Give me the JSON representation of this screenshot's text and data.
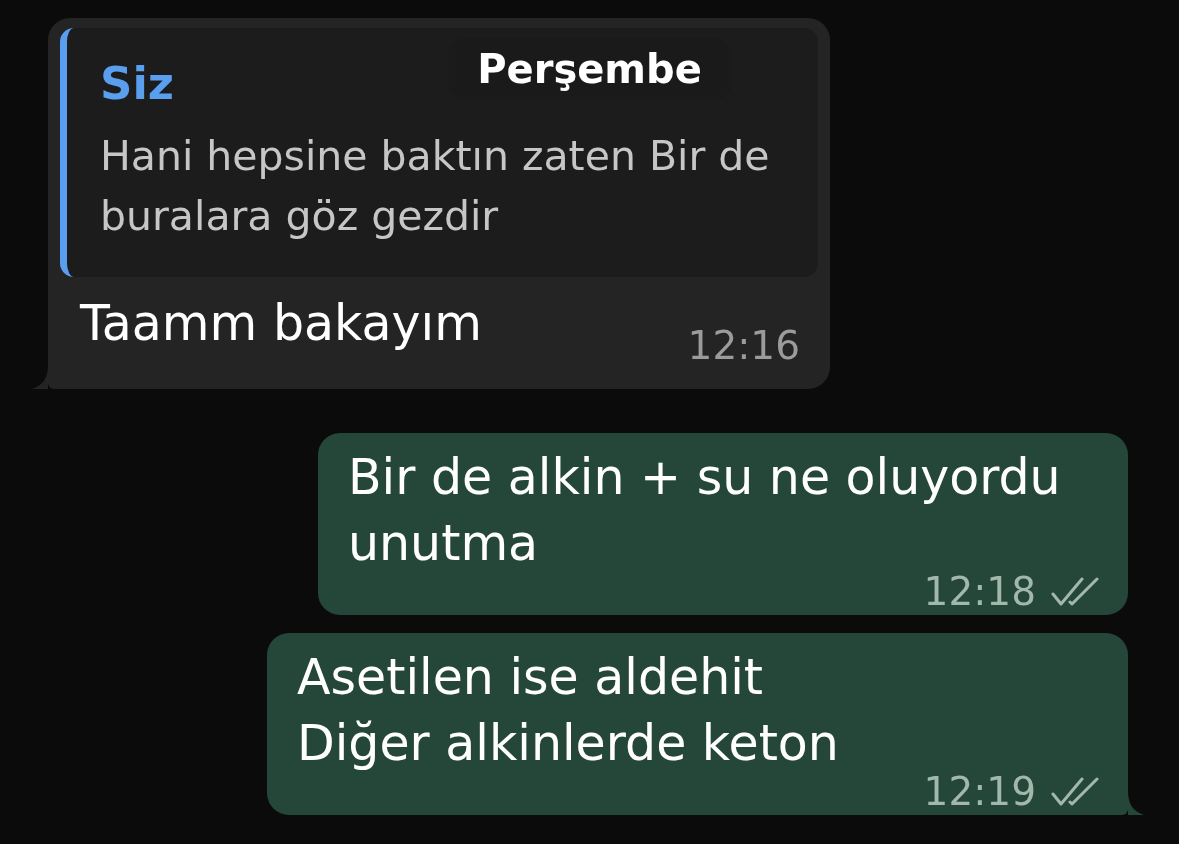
{
  "date_header": "Perşembe",
  "messages": [
    {
      "kind": "incoming",
      "tail": true,
      "reply": {
        "author": "Siz",
        "text": "Hani hepsine baktın zaten Bir de buralara göz gezdir"
      },
      "text": "Taamm bakayım",
      "time": "12:16"
    },
    {
      "kind": "outgoing",
      "tail": false,
      "text": "Bir de alkin + su ne oluyordu unutma",
      "time": "12:18",
      "read": false
    },
    {
      "kind": "outgoing",
      "tail": true,
      "text": "Asetilen ise aldehit\nDiğer alkinlerde keton",
      "time": "12:19",
      "read": false
    }
  ]
}
